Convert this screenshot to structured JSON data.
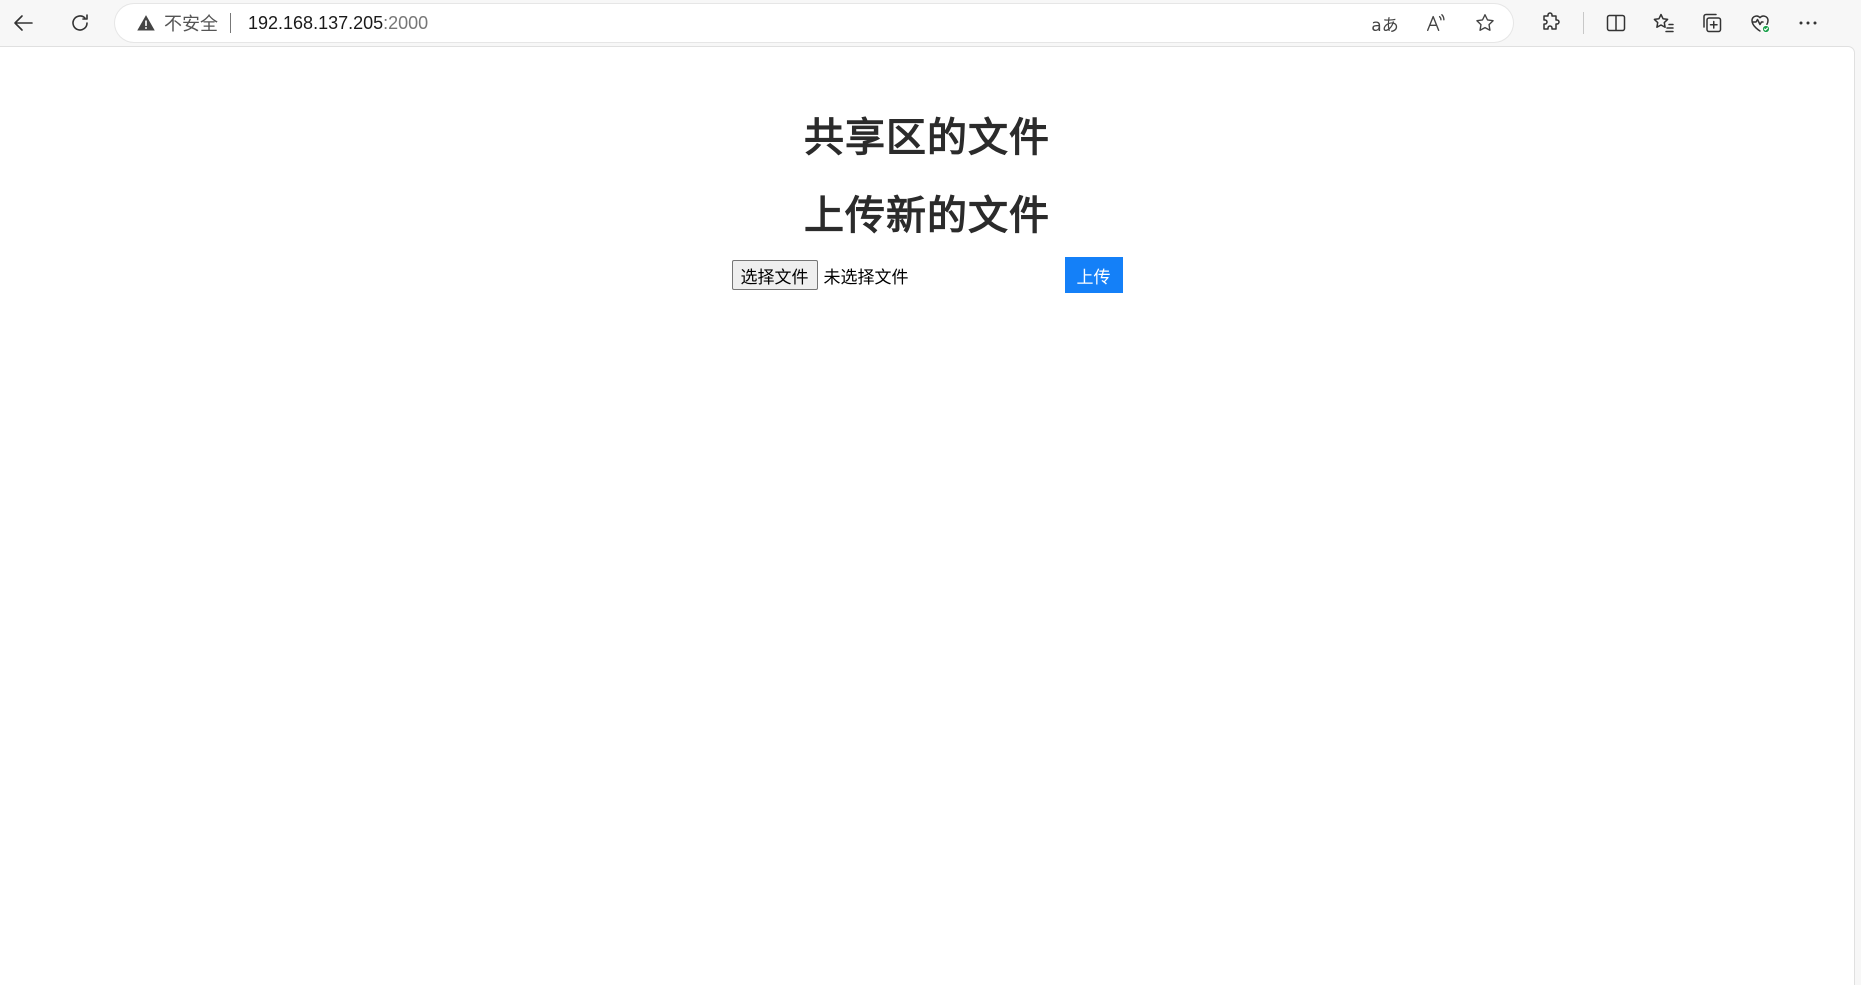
{
  "browser": {
    "security_label": "不安全",
    "url_host": "192.168.137.205",
    "url_port": ":2000",
    "translate_glyph": "aあ",
    "read_aloud_glyph": "A"
  },
  "page": {
    "shared_files_heading": "共享区的文件",
    "upload_heading": "上传新的文件",
    "choose_file_label": "选择文件",
    "no_file_selected": "未选择文件",
    "upload_button_label": "上传"
  },
  "colors": {
    "upload_button": "#1480f8",
    "heading_text": "#2b2b2b"
  }
}
